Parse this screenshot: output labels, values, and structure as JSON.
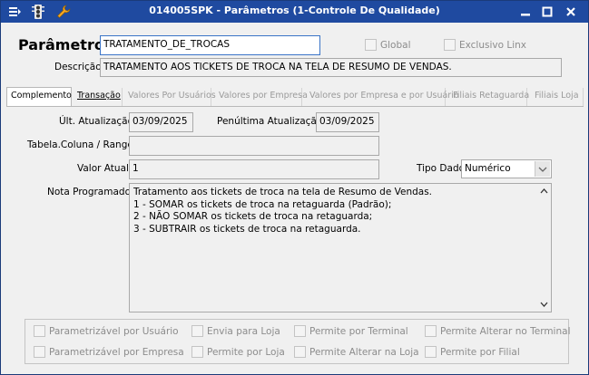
{
  "window": {
    "title": "014005SPK - Parâmetros (1-Controle De Qualidade)",
    "titlebar_color": "#1f4aa0",
    "icons": [
      "hamburger-icon",
      "traffic-light-icon",
      "wrench-icon"
    ],
    "controls": {
      "minimize": "minimize-icon",
      "maximize": "maximize-icon",
      "close": "close-icon"
    }
  },
  "header": {
    "parametro_label": "Parâmetro",
    "parametro_value": "TRATAMENTO_DE_TROCAS",
    "global_label": "Global",
    "exclusivo_label": "Exclusivo Linx",
    "descricao_label": "Descrição",
    "descricao_value": "TRATAMENTO AOS TICKETS DE TROCA NA TELA DE RESUMO DE VENDAS."
  },
  "tabs": [
    {
      "label": "Complemento",
      "state": "active"
    },
    {
      "label": "Transação",
      "state": "enabled"
    },
    {
      "label": "Valores Por Usuários",
      "state": "disabled"
    },
    {
      "label": "Valores por Empresa",
      "state": "disabled"
    },
    {
      "label": "Valores por Empresa e por Usuário",
      "state": "disabled"
    },
    {
      "label": "Filiais Retaguarda",
      "state": "disabled"
    },
    {
      "label": "Filiais Loja",
      "state": "disabled"
    }
  ],
  "complemento": {
    "ult_atualizacao_label": "Últ. Atualização",
    "ult_atualizacao_value": "03/09/2025",
    "penultima_label": "Penúltima Atualização",
    "penultima_value": "03/09/2025",
    "tabela_label": "Tabela.Coluna / Range",
    "tabela_value": "",
    "valor_atual_label": "Valor Atual",
    "valor_atual_value": "1",
    "tipo_dado_label": "Tipo Dado",
    "tipo_dado_value": "Numérico",
    "nota_label": "Nota Programador",
    "nota_lines": [
      "Tratamento aos tickets de troca na tela de Resumo de Vendas.",
      "1 - SOMAR os tickets de troca na retaguarda (Padrão);",
      "2 - NÃO SOMAR os tickets de troca na retaguarda;",
      "3 - SUBTRAIR os tickets de troca na retaguarda."
    ]
  },
  "options": [
    "Parametrizável por Usuário",
    "Envia para Loja",
    "Permite por Terminal",
    "Permite Alterar no Terminal",
    "Parametrizável por Empresa",
    "Permite por Loja",
    "Permite Alterar na Loja",
    "Permite por Filial"
  ]
}
